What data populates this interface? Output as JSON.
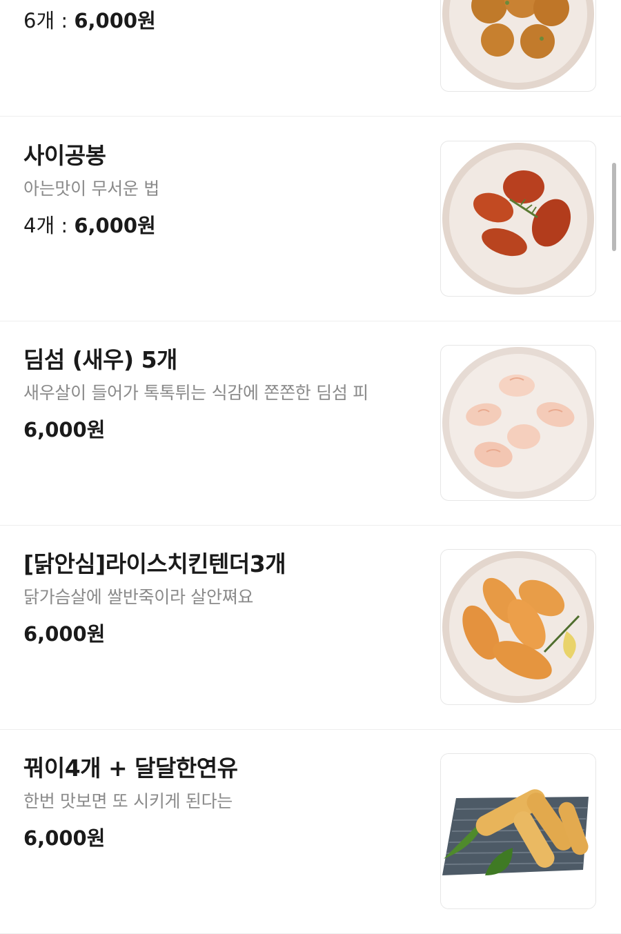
{
  "menu": [
    {
      "name": "",
      "description": "",
      "qty": "6개 : ",
      "price": "6,000원",
      "image_icon": "fried-balls-plate-icon"
    },
    {
      "name": "사이공봉",
      "description": "아는맛이 무서운 법",
      "qty": "4개 : ",
      "price": "6,000원",
      "image_icon": "chicken-wings-plate-icon"
    },
    {
      "name": "딤섬 (새우) 5개",
      "description": "새우살이 들어가 톡톡튀는 식감에 쫀쫀한 딤섬 피",
      "qty": "",
      "price": "6,000원",
      "image_icon": "shrimp-dimsum-plate-icon"
    },
    {
      "name": "[닭안심]라이스치킨텐더3개",
      "description": "닭가슴살에 쌀반죽이라 살안쪄요",
      "qty": "",
      "price": "6,000원",
      "image_icon": "rice-chicken-tender-plate-icon"
    },
    {
      "name": "꿔이4개 + 달달한연유",
      "description": "한번 맛보면 또 시키게 된다는",
      "qty": "",
      "price": "6,000원",
      "image_icon": "fried-dough-sticks-icon"
    }
  ],
  "colors": {
    "text": "#1a1a1a",
    "description": "#8a8a8a",
    "divider": "#eeeeee",
    "plate": "#efe6e0"
  }
}
